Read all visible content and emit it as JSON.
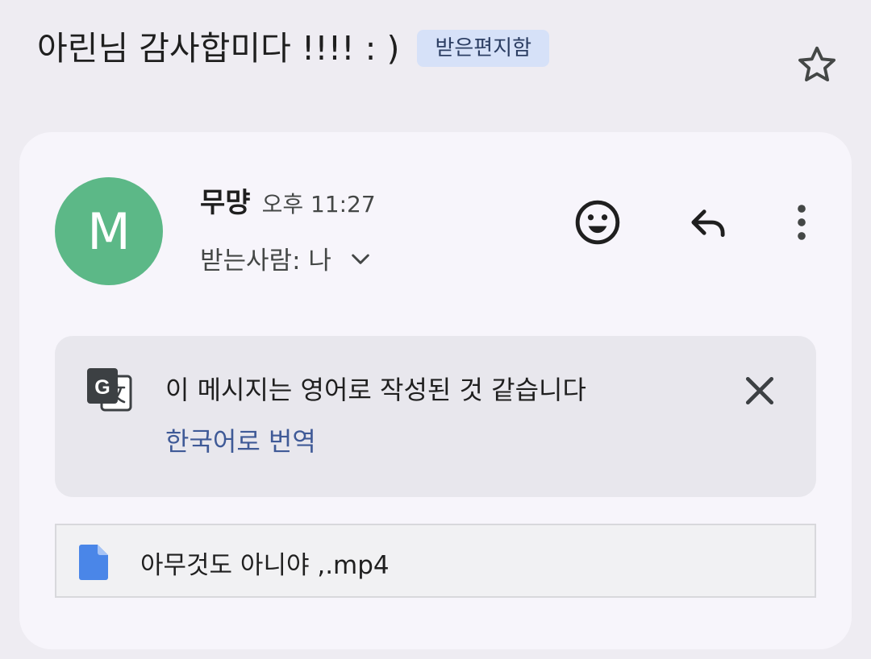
{
  "email": {
    "subject": "아린님 감사합미다 !!!! : )",
    "label": "받은편지함",
    "sender": {
      "name": "무먕",
      "avatar_initial": "M",
      "time": "오후 11:27",
      "recipient": "받는사람: 나"
    },
    "translation": {
      "message": "이 메시지는 영어로 작성된 것 같습니다",
      "link": "한국어로 번역"
    },
    "attachment": {
      "filename": "아무것도 아니야 ,.mp4"
    }
  },
  "icons": {
    "star": "star-icon",
    "emoji": "emoji-icon",
    "reply": "reply-icon",
    "more": "more-vert-icon",
    "chevron": "chevron-down-icon",
    "translate": "translate-icon",
    "close": "close-icon",
    "file": "file-icon"
  },
  "colors": {
    "background": "#eeecf2",
    "card": "#f7f5fb",
    "avatar": "#5cb887",
    "label_chip": "#d6e1f8",
    "link": "#3f5a97",
    "file_icon": "#4a86e8"
  }
}
